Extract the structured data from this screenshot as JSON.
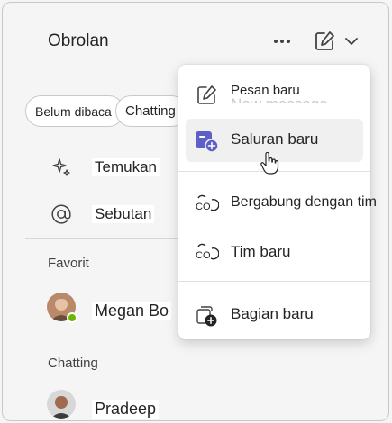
{
  "header": {
    "title": "Obrolan",
    "more_icon": "more-horizontal-icon",
    "compose_icon": "compose-icon",
    "chevron_icon": "chevron-down-icon"
  },
  "filters": [
    "Belum dibaca",
    "Chatting"
  ],
  "nav": {
    "discover": {
      "label": "Temukan",
      "icon": "sparkle-icon"
    },
    "mentions": {
      "label": "Sebutan",
      "icon": "at-sign-icon"
    }
  },
  "sections": {
    "favorites": {
      "label": "Favorit",
      "contacts": [
        {
          "name": "Megan Bo",
          "status": "available"
        }
      ]
    },
    "chats": {
      "label": "Chatting",
      "contacts": [
        {
          "name": "Pradeep"
        }
      ]
    }
  },
  "menu": {
    "items": [
      {
        "label": "Pesan baru",
        "ghost_label": "New message",
        "icon": "compose-icon"
      },
      {
        "label": "Saluran baru",
        "icon": "channel-add-icon",
        "highlighted": true
      },
      {
        "label": "Bergabung dengan tim",
        "icon": "team-join-icon"
      },
      {
        "label": "Tim baru",
        "icon": "team-new-icon"
      },
      {
        "label": "Bagian baru",
        "icon": "section-add-icon"
      }
    ]
  },
  "colors": {
    "accent": "#5b5fc7",
    "presence": "#6bb700",
    "background": "#f5f5f5",
    "highlight": "#f0f0f0"
  }
}
